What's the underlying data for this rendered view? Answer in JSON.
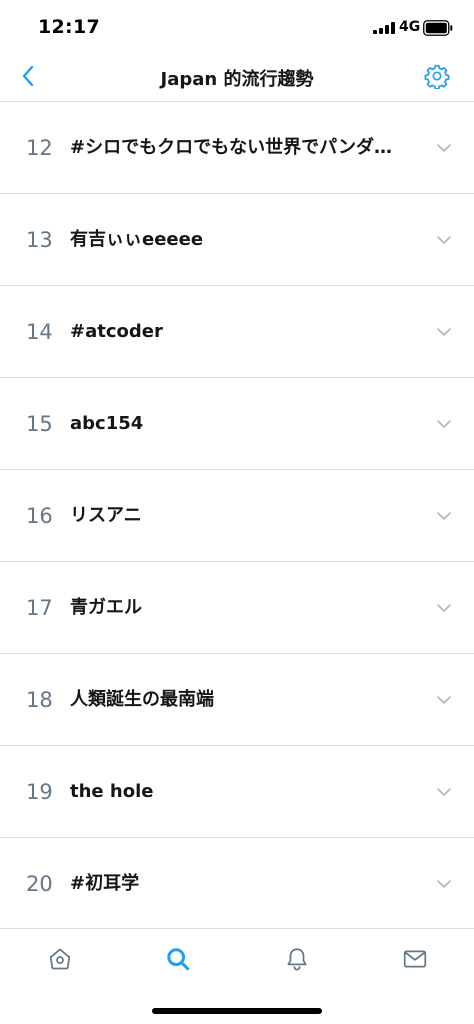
{
  "status_bar": {
    "time": "12:17",
    "network": "4G"
  },
  "header": {
    "title": "Japan 的流行趨勢"
  },
  "trends": [
    {
      "rank": "12",
      "name": "#シロでもクロでもない世界でパンダ…"
    },
    {
      "rank": "13",
      "name": "有吉ぃぃeeeee"
    },
    {
      "rank": "14",
      "name": "#atcoder"
    },
    {
      "rank": "15",
      "name": "abc154"
    },
    {
      "rank": "16",
      "name": "リスアニ"
    },
    {
      "rank": "17",
      "name": "青ガエル"
    },
    {
      "rank": "18",
      "name": "人類誕生の最南端"
    },
    {
      "rank": "19",
      "name": "the hole"
    },
    {
      "rank": "20",
      "name": "#初耳学"
    }
  ],
  "tab_bar": {
    "tabs": [
      {
        "icon": "home-icon",
        "active": false
      },
      {
        "icon": "search-icon",
        "active": true
      },
      {
        "icon": "bell-icon",
        "active": false
      },
      {
        "icon": "mail-icon",
        "active": false
      }
    ]
  },
  "colors": {
    "accent": "#1da1f2",
    "text": "#14171a",
    "secondary": "#657786",
    "divider": "#d8dde1"
  }
}
